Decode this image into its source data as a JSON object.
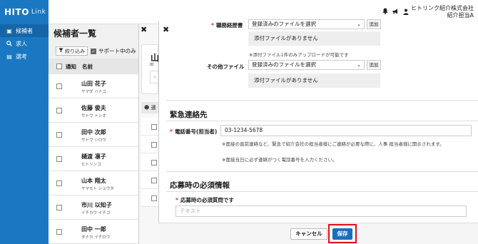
{
  "app": {
    "logo_main": "HITO",
    "logo_sub": "Link"
  },
  "sidebar": {
    "items": [
      {
        "label": "候補者",
        "icon": "person-icon"
      },
      {
        "label": "求人",
        "icon": "search-icon"
      },
      {
        "label": "選考",
        "icon": "document-icon"
      }
    ]
  },
  "header": {
    "company": "ヒトリンク紹介株式会社",
    "user": "紹介担当A"
  },
  "candidates": {
    "title": "候補者一覧",
    "filter_label": "絞り込み",
    "support_only_label": "サポート中のみ",
    "columns": {
      "notify": "通知",
      "name": "名前"
    },
    "rows": [
      {
        "name": "山田 花子",
        "kana": "ヤマダ ハナコ"
      },
      {
        "name": "佐藤 俊夫",
        "kana": "サトウ トシオ"
      },
      {
        "name": "田中 次郎",
        "kana": "サトウ ジロウ"
      },
      {
        "name": "樋渡 凛子",
        "kana": "ヒトリンコ"
      },
      {
        "name": "山本 翔太",
        "kana": "ヤマモト ショウタ"
      },
      {
        "name": "市川 以知子",
        "kana": "イチカワ イチコ"
      },
      {
        "name": "田中 一郎",
        "kana": "タナカ イチロウ"
      }
    ]
  },
  "detail_behind": {
    "name_initial": "山",
    "id_label": "ID",
    "tab_label": "選"
  },
  "modal": {
    "resume_label": "職務経歴書",
    "select_placeholder": "登録済みのファイルを選択",
    "add_label": "追加",
    "no_file_text": "添付ファイルがありません",
    "upload_note": "※添付ファイル1件のみアップロードが可能です",
    "other_files_label": "その他ファイル",
    "emergency_title": "緊急連絡先",
    "phone_label": "電話番号(担当者)",
    "phone_value": "03-1234-5678",
    "phone_note_1": "※面接の直前連絡など、緊急で紹介会社の担当者様にご連絡が必要な際に、人事 担当者様に開示されます。",
    "phone_note_2": "※面接当日に必ず連絡がつく電話番号を入力ください。",
    "required_title": "応募時の必須情報",
    "required_question_label": "応募時の必須質問です",
    "text_placeholder": "テキスト",
    "cancel_label": "キャンセル",
    "save_label": "保存"
  },
  "colors": {
    "brand": "#1a78c2",
    "save": "#1a6fbd",
    "highlight": "#e0101a",
    "required": "#d0342c"
  }
}
